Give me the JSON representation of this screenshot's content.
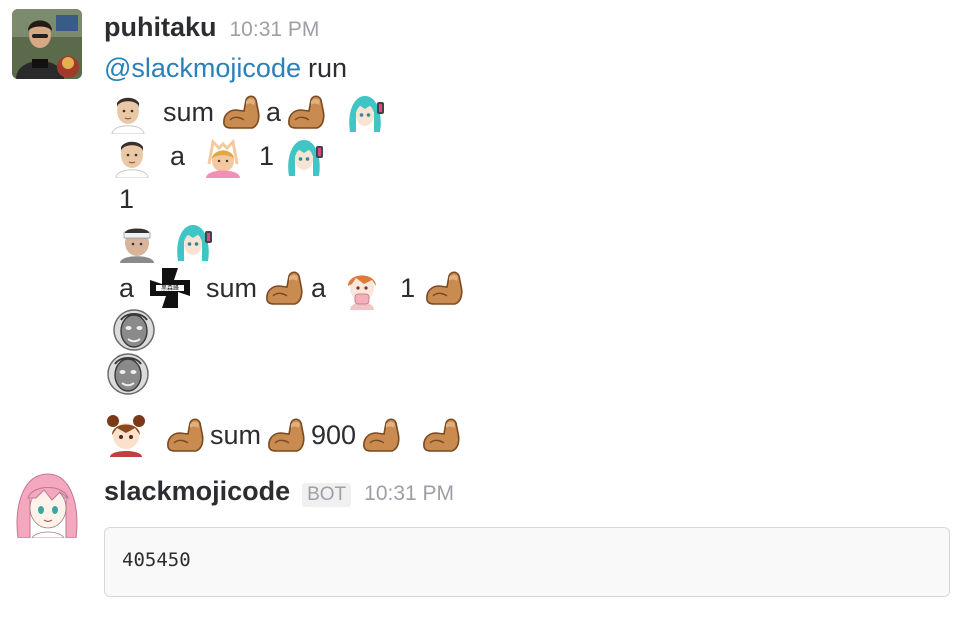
{
  "messages": [
    {
      "user": "puhitaku",
      "time": "10:31 PM",
      "mention": "@slackmojicode",
      "command": "run",
      "lines": {
        "l1": [
          "sum",
          "a"
        ],
        "l2": [
          "a",
          "1"
        ],
        "l3": [
          "1"
        ],
        "l5": [
          "a",
          "sum",
          "a",
          "1"
        ],
        "l8": [
          "sum",
          "900"
        ]
      },
      "icons": {
        "avatar": "photo-avatar-icon",
        "man_face": "man-face-icon",
        "muscle": "flexed-biceps-icon",
        "miku": "teal-hair-girl-icon",
        "face": "man-face-icon",
        "person": "person-gesturing-ok-icon",
        "headband_man": "headband-man-icon",
        "cross": "black-cross-icon",
        "anime_girl": "anime-girl-icon",
        "mask": "stone-mask-icon",
        "bear_girl": "brown-hair-girl-icon"
      }
    },
    {
      "user": "slackmojicode",
      "badge": "BOT",
      "time": "10:31 PM",
      "code": "405450",
      "icons": {
        "avatar": "pink-hair-anime-avatar-icon"
      }
    }
  ],
  "colors": {
    "text": "#2c2d30",
    "timestamp": "#9e9ea6",
    "mention": "#2a80b9",
    "code_bg": "#f9f9f9",
    "code_border": "#d8d8d8"
  }
}
